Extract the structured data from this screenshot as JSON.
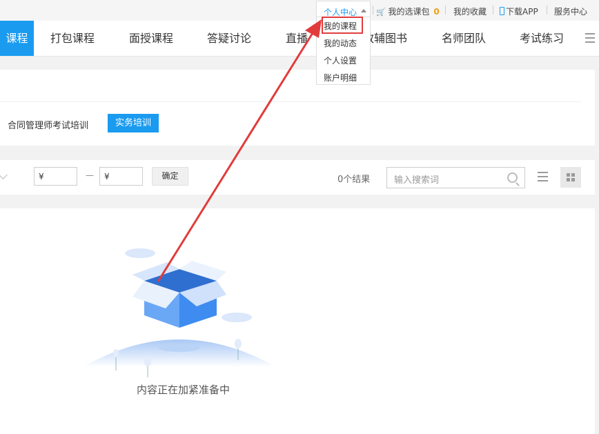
{
  "topbar": {
    "user_center": "个人中心",
    "course_bag": "我的选课包",
    "course_bag_count": "0",
    "favorites": "我的收藏",
    "download_app": "下载APP",
    "service": "服务中心"
  },
  "dropdown": {
    "items": [
      "我的课程",
      "我的动态",
      "个人设置",
      "账户明细"
    ]
  },
  "nav": {
    "active": "课程",
    "items": [
      "打包课程",
      "面授课程",
      "答疑讨论",
      "直播",
      "教辅图书",
      "名师团队",
      "考试练习"
    ]
  },
  "filter": {
    "category": "合同管理师考试培训",
    "active_tag": "实务培训"
  },
  "toolbar": {
    "price_min": "¥",
    "price_max": "¥",
    "price_dash": "—",
    "confirm": "确定",
    "results": "0个结果",
    "search_placeholder": "输入搜索词"
  },
  "empty": {
    "message": "内容正在加紧准备中"
  },
  "colors": {
    "primary": "#1a9bf0",
    "highlight": "#e23b3b",
    "badge": "#f39c12"
  }
}
